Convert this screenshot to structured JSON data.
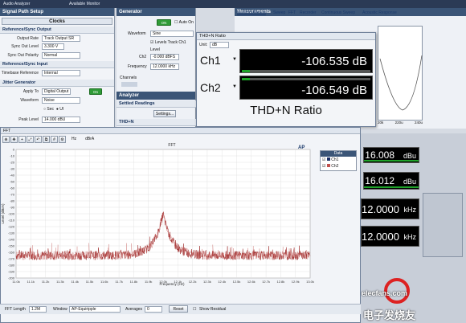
{
  "topbar": {
    "left_text": "Audio Analyzer",
    "center_text": "Available Monitor"
  },
  "signal_path": {
    "title": "Signal Path Setup",
    "clocks_label": "Clocks",
    "ref_sync_output_title": "Reference/Sync Output",
    "output_rate_label": "Output Rate",
    "output_rate_value": "Track Output SR",
    "sync_out_level_label": "Sync Out Level",
    "sync_out_level_value": "3.300 V",
    "sync_out_polarity_label": "Sync Out Polarity",
    "sync_out_polarity_value": "Normal",
    "ref_sync_input_title": "Reference/Sync Input",
    "timebase_ref_label": "Timebase Reference",
    "timebase_ref_value": "Internal",
    "jitter_title": "Jitter Generator",
    "apply_to_label": "Apply To",
    "apply_to_value": "Digital Output",
    "apply_toggle": "On",
    "waveform_label": "Waveform",
    "waveform_value": "Noise",
    "sec_label": "Sec",
    "ui_label": "UI",
    "peak_level_label": "Peak Level",
    "peak_level_value": "14.000 dBU"
  },
  "generator": {
    "title": "Generator",
    "on_toggle": "ON",
    "auto_on_label": "Auto On",
    "waveform_label": "Waveform",
    "waveform_value": "Sine",
    "levels_track_label": "Levels Track Ch1",
    "level_label": "Level",
    "ch2_label": "Ch2",
    "ch2_value": "-0.000 dBFS",
    "frequency_label": "Frequency",
    "frequency_value": "12.0000 kHz",
    "channels_label": "Channels"
  },
  "analyzer": {
    "title": "Analyzer",
    "settled_readings_label": "Settled Readings",
    "settings_button": "Settings...",
    "thdn_label": "THD+N"
  },
  "measurements": {
    "title": "Measurements",
    "tabs": [
      "Monitors/Meters",
      "Sweep",
      "FFT",
      "Recorder",
      "Continuous Sweep",
      "Acoustic Response"
    ],
    "bg_x_ticks": [
      "20k",
      "220u",
      "240u"
    ],
    "readings": [
      {
        "value": "16.008",
        "unit": "dBu"
      },
      {
        "value": "16.012",
        "unit": "dBu"
      },
      {
        "value": "12.0000",
        "unit": "kHz"
      },
      {
        "value": "12.0000",
        "unit": "kHz"
      }
    ]
  },
  "thdn_window": {
    "title": "THD+N Ratio",
    "unit_label": "Unit:",
    "unit_value": "dB",
    "rows": [
      {
        "channel": "Ch1",
        "value": "-106.535 dB"
      },
      {
        "channel": "Ch2",
        "value": "-106.549 dB"
      }
    ],
    "footer": "THD+N Ratio"
  },
  "fft": {
    "window_title": "FFT",
    "plot_title": "FFT",
    "x_axis_unit": "Hz",
    "y_axis_unit": "dBrA",
    "ylabel": "Level (dBrA)",
    "xlabel": "Frequency (Hz)",
    "legend_title": "Data",
    "legend_items": [
      "Ch1",
      "Ch2"
    ],
    "fft_length_label": "FFT Length",
    "fft_length_value": "1.2M",
    "window_label": "Window",
    "window_value": "AP-Equiripple",
    "averages_label": "Averages",
    "averages_value": "0",
    "reset_button": "Reset",
    "show_residual_label": "Show Residual"
  },
  "watermark": {
    "text": "电子发烧友",
    "sub": "elecfans.com"
  },
  "colors": {
    "trace_ch1": "#9e2b2b",
    "trace_ch2": "#c0504d",
    "meter_green": "#1fa32a",
    "panel_header": "#3b5577"
  },
  "chart_data": {
    "type": "line",
    "title": "FFT",
    "xlabel": "Frequency (Hz)",
    "ylabel": "Level (dBrA)",
    "x_ticks": [
      "11.0k",
      "11.1k",
      "11.2k",
      "11.3k",
      "11.4k",
      "11.5k",
      "11.6k",
      "11.7k",
      "11.8k",
      "11.9k",
      "12.0k",
      "12.1k",
      "12.2k",
      "12.3k",
      "12.4k",
      "12.5k",
      "12.6k",
      "12.7k",
      "12.8k",
      "12.9k",
      "13.0k"
    ],
    "y_ticks": [
      0,
      -10,
      -20,
      -30,
      -40,
      -50,
      -60,
      -70,
      -80,
      -90,
      -100,
      -110,
      -120,
      -130,
      -140,
      -150,
      -160,
      -170,
      -180,
      -190,
      -200
    ],
    "xlim": [
      11000,
      13000
    ],
    "ylim": [
      -200,
      0
    ],
    "grid": true,
    "legend_placement": "top-right",
    "series": [
      {
        "name": "Ch1",
        "noise_floor_db": -165,
        "peak_freq_hz": 12000,
        "peak_db": -100
      },
      {
        "name": "Ch2",
        "noise_floor_db": -165,
        "peak_freq_hz": 12000,
        "peak_db": -100
      }
    ]
  }
}
